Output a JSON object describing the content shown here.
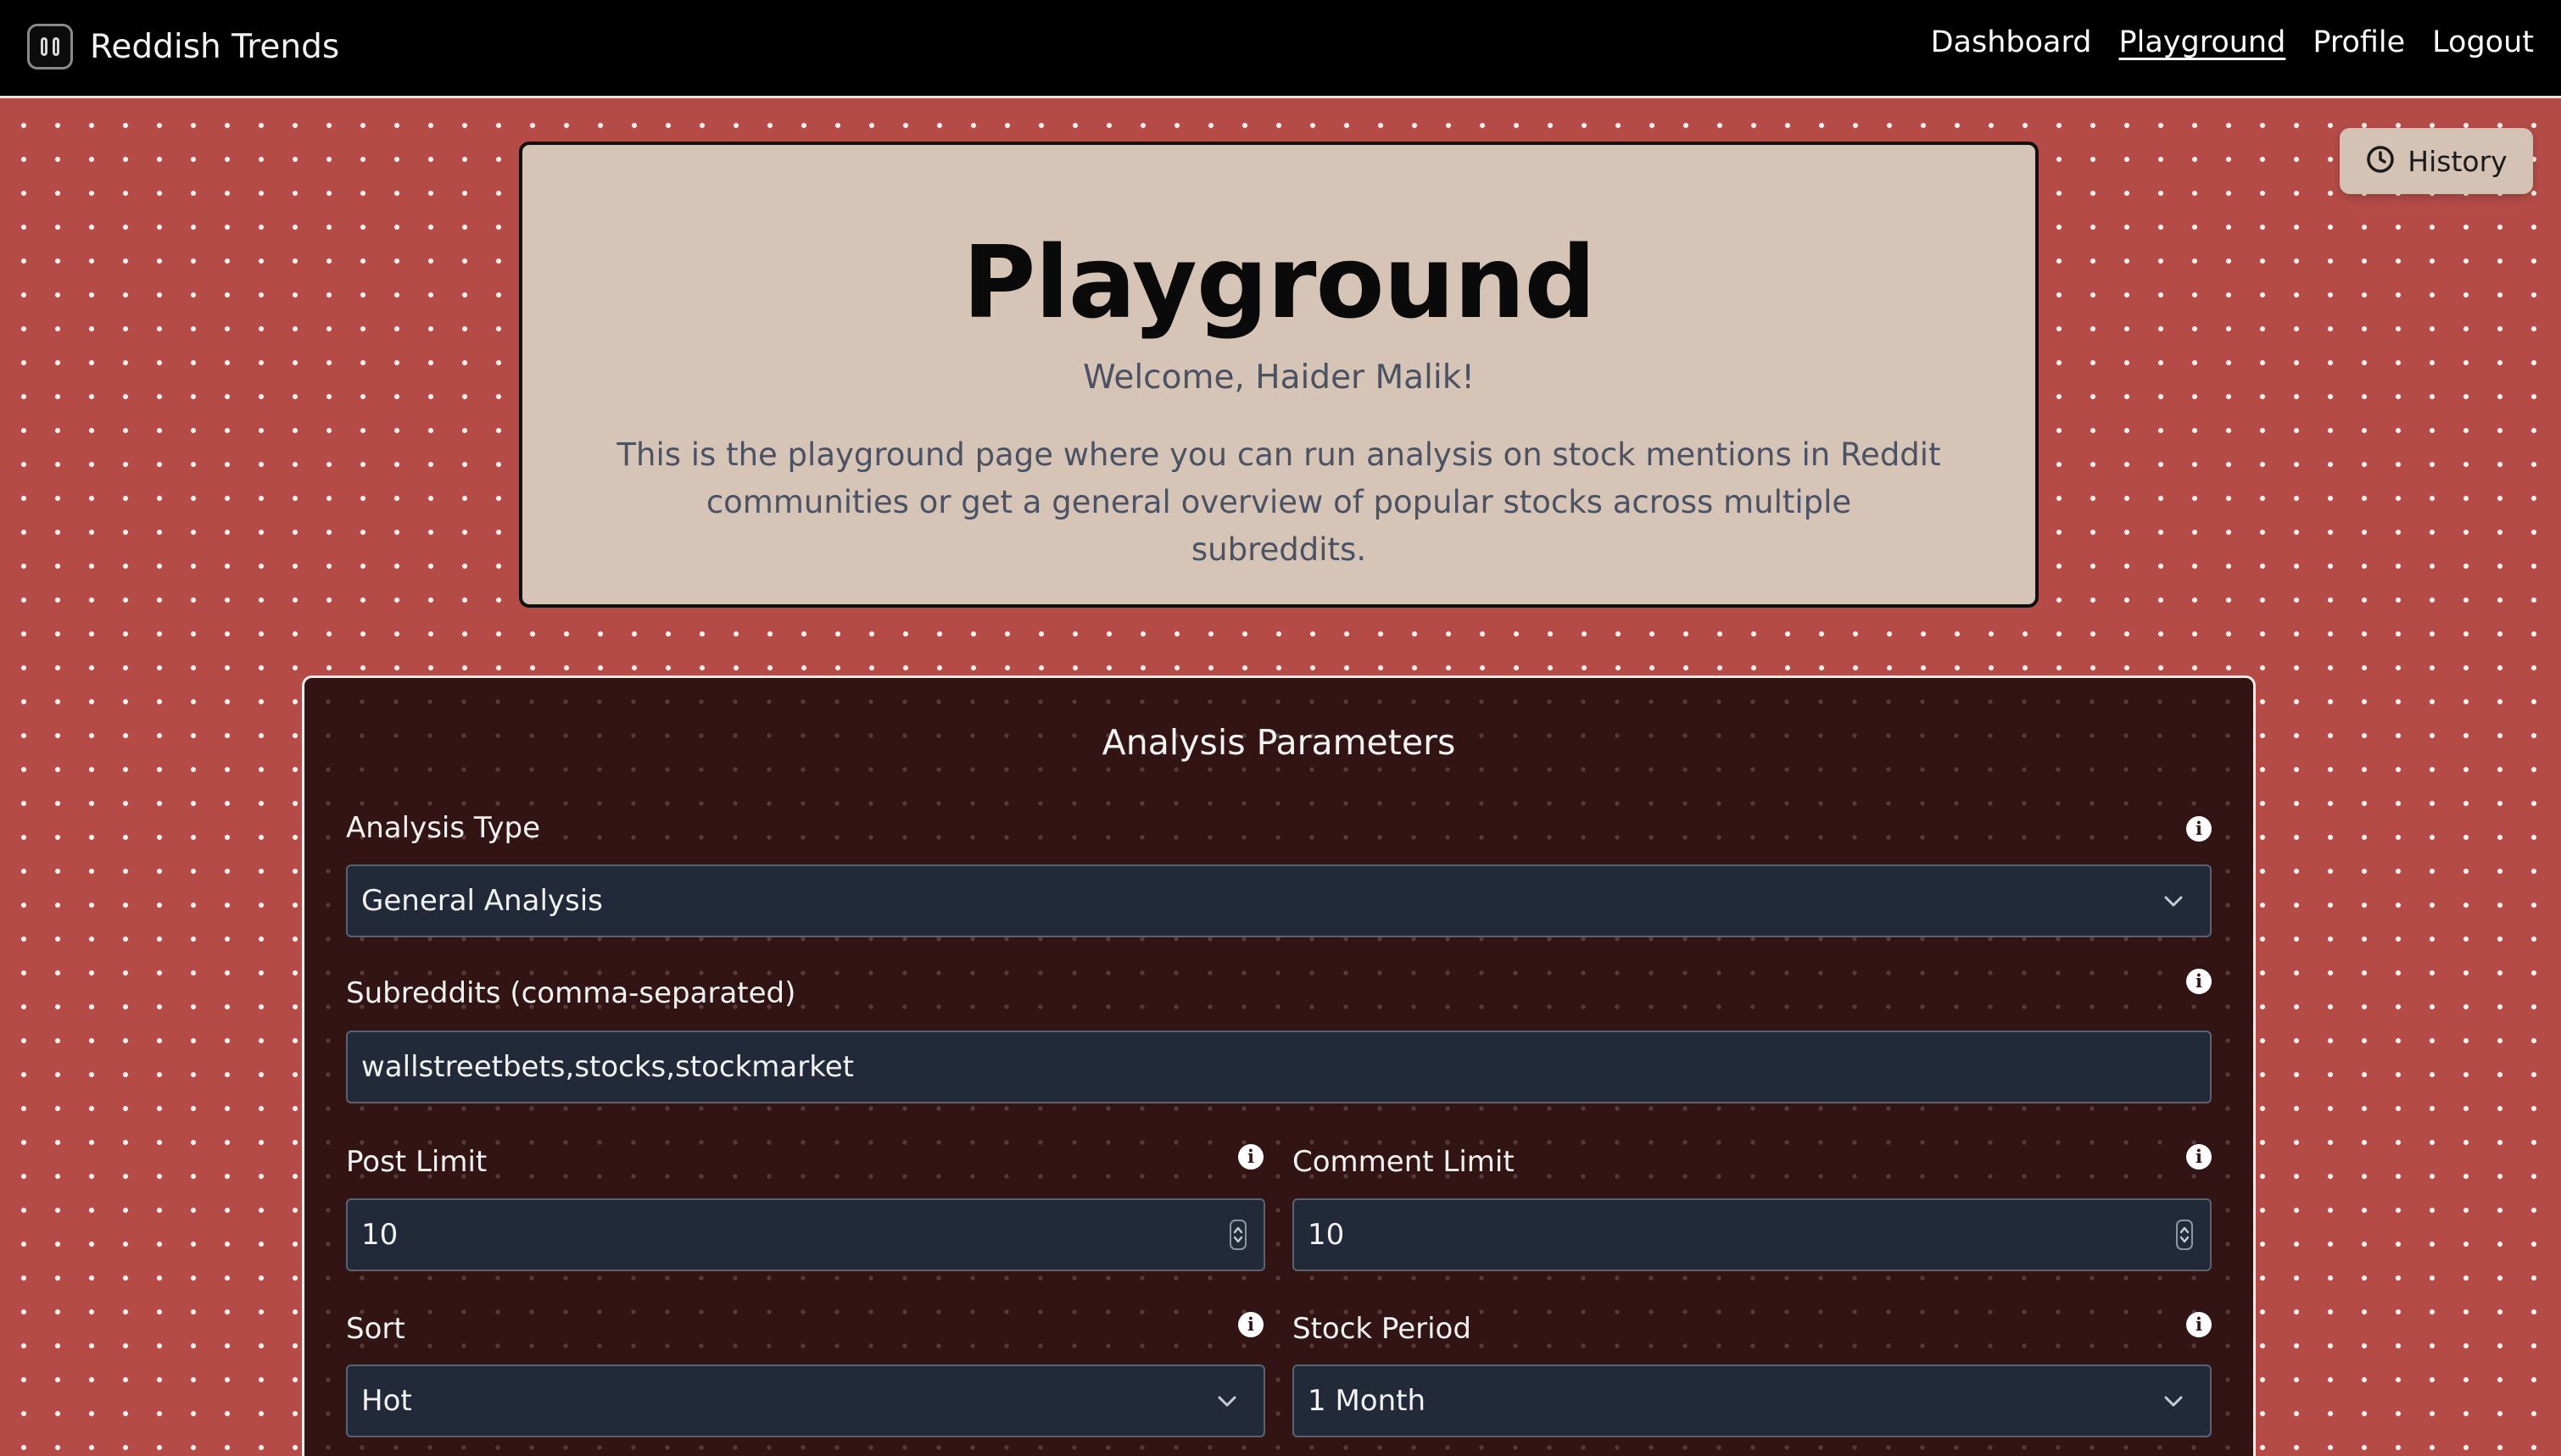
{
  "nav": {
    "brand": "Reddish Trends",
    "links": [
      "Dashboard",
      "Playground",
      "Profile",
      "Logout"
    ]
  },
  "history_button": {
    "label": "History",
    "icon": "clock-icon"
  },
  "hero": {
    "title": "Playground",
    "welcome": "Welcome, Haider Malik!",
    "description": "This is the playground page where you can run analysis on stock mentions in Reddit communities or get a general overview of popular stocks across multiple subreddits."
  },
  "params": {
    "title": "Analysis Parameters",
    "analysis_type": {
      "label": "Analysis Type",
      "value": "General Analysis"
    },
    "subreddits": {
      "label": "Subreddits (comma-separated)",
      "value": "wallstreetbets,stocks,stockmarket"
    },
    "post_limit": {
      "label": "Post Limit",
      "value": "10"
    },
    "comment_limit": {
      "label": "Comment Limit",
      "value": "10"
    },
    "sort": {
      "label": "Sort",
      "value": "Hot"
    },
    "stock_period": {
      "label": "Stock Period",
      "value": "1 Month"
    }
  },
  "colors": {
    "page_background": "#b44b47",
    "navbar": "#000000",
    "hero_card": "#d6c4b6",
    "panel": "#331415",
    "input": "#222a39"
  }
}
